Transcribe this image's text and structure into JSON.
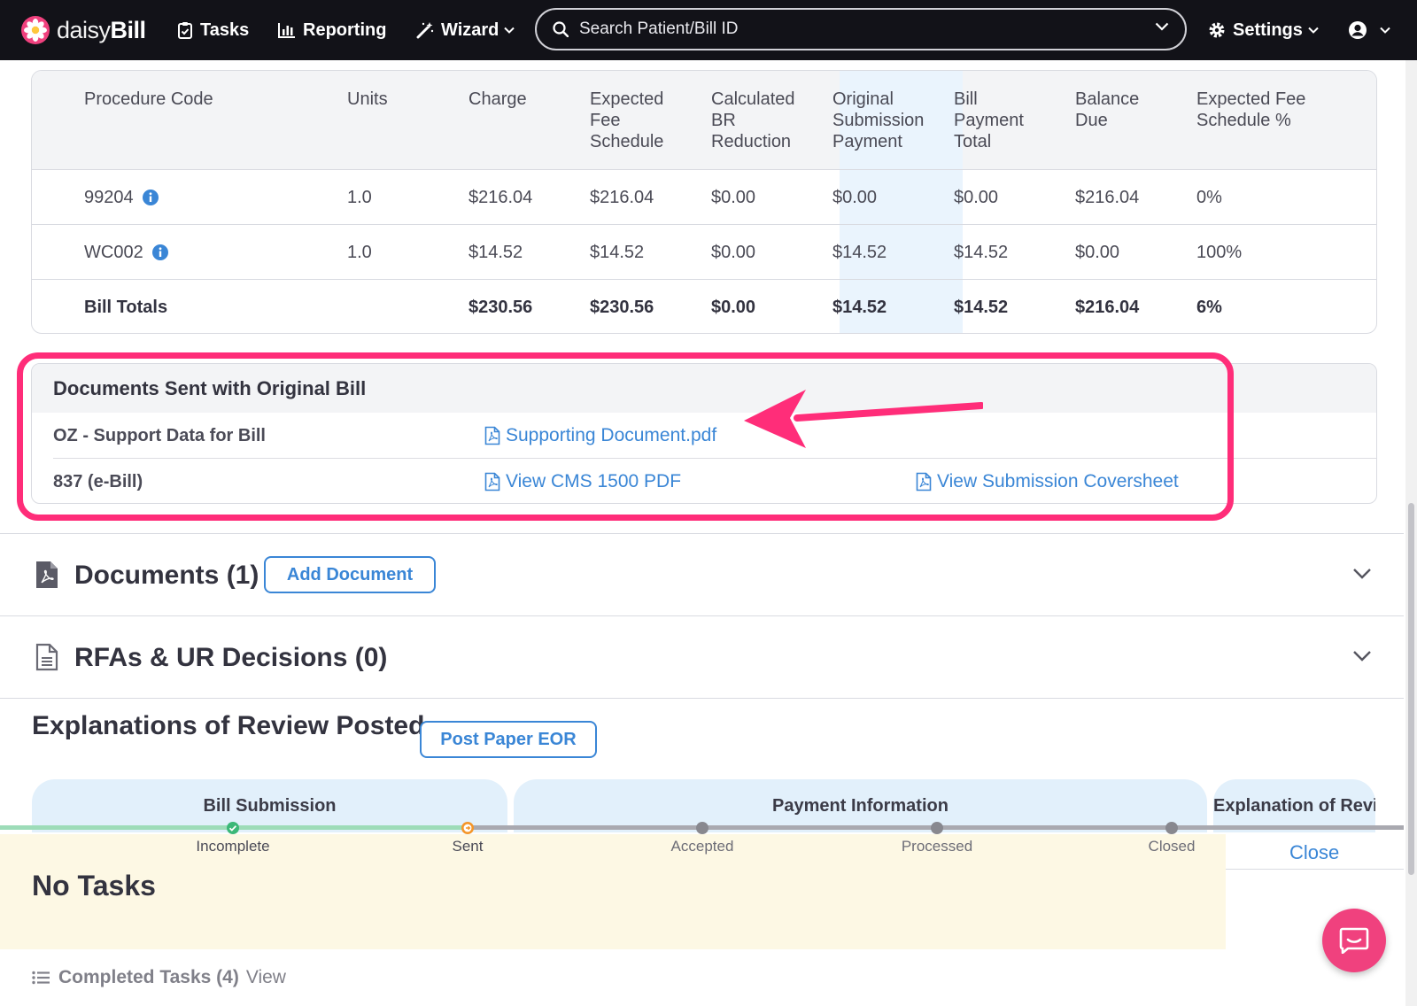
{
  "nav": {
    "brand_light": "daisy",
    "brand_bold": "Bill",
    "tasks": "Tasks",
    "reporting": "Reporting",
    "wizard": "Wizard",
    "settings": "Settings",
    "search_placeholder": "Search Patient/Bill ID"
  },
  "procedure_table": {
    "headers": {
      "code": "Procedure Code",
      "units": "Units",
      "charge": "Charge",
      "expected_fee": "Expected Fee Schedule",
      "br_reduction": "Calculated BR Reduction",
      "orig_payment": "Original Submission Payment",
      "payment_total": "Bill Payment Total",
      "balance_due": "Balance Due",
      "fee_pct": "Expected Fee Schedule %"
    },
    "rows": [
      {
        "code": "99204",
        "units": "1.0",
        "charge": "$216.04",
        "expected_fee": "$216.04",
        "br_reduction": "$0.00",
        "orig_payment": "$0.00",
        "payment_total": "$0.00",
        "balance_due": "$216.04",
        "fee_pct": "0%"
      },
      {
        "code": "WC002",
        "units": "1.0",
        "charge": "$14.52",
        "expected_fee": "$14.52",
        "br_reduction": "$0.00",
        "orig_payment": "$14.52",
        "payment_total": "$14.52",
        "balance_due": "$0.00",
        "fee_pct": "100%"
      }
    ],
    "totals": {
      "label": "Bill Totals",
      "charge": "$230.56",
      "expected_fee": "$230.56",
      "br_reduction": "$0.00",
      "orig_payment": "$14.52",
      "payment_total": "$14.52",
      "balance_due": "$216.04",
      "fee_pct": "6%"
    }
  },
  "docs_sent": {
    "title": "Documents Sent with Original Bill",
    "rows": [
      {
        "label": "OZ - Support Data for Bill",
        "link1": "Supporting Document.pdf"
      },
      {
        "label": "837 (e-Bill)",
        "link1": "View CMS 1500 PDF",
        "link2": "View Submission Coversheet"
      }
    ]
  },
  "sections": {
    "documents": {
      "title": "Documents (1)",
      "button": "Add Document"
    },
    "rfas": {
      "title": "RFAs & UR Decisions (0)"
    }
  },
  "eor": {
    "title": "Explanations of Review Posted",
    "button": "Post Paper EOR",
    "tabs": [
      "Bill Submission",
      "Payment Information",
      "Explanation of Review"
    ]
  },
  "tracker": {
    "steps": [
      "Incomplete",
      "Sent",
      "Accepted",
      "Processed",
      "Closed"
    ],
    "colors": {
      "complete": "#3cb878",
      "current": "#f4962a",
      "pending": "#88888f"
    }
  },
  "tasks": {
    "empty_label": "No Tasks",
    "close": "Close",
    "completed_label": "Completed Tasks (4)",
    "completed_view": "View"
  },
  "colors": {
    "accent": "#3a86d6",
    "annotation": "#ff2d79",
    "brand": "#f0417e"
  }
}
